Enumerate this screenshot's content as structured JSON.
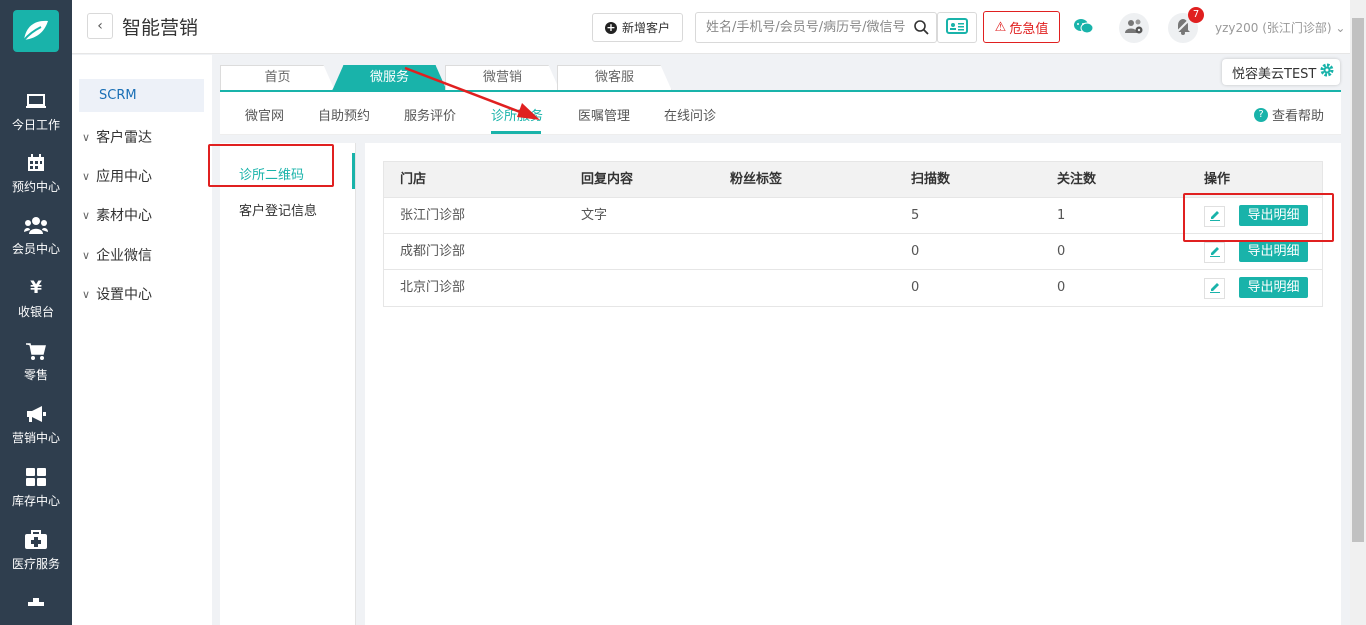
{
  "nav": {
    "items": [
      {
        "label": "今日工作",
        "icon": "monitor-icon"
      },
      {
        "label": "预约中心",
        "icon": "calendar-icon"
      },
      {
        "label": "会员中心",
        "icon": "users-icon"
      },
      {
        "label": "收银台",
        "icon": "yen-icon"
      },
      {
        "label": "零售",
        "icon": "cart-icon"
      },
      {
        "label": "营销中心",
        "icon": "megaphone-icon"
      },
      {
        "label": "库存中心",
        "icon": "grid-icon"
      },
      {
        "label": "医疗服务",
        "icon": "medkit-icon"
      }
    ]
  },
  "header": {
    "title": "智能营销",
    "new_customer": "新增客户",
    "search_placeholder": "姓名/手机号/会员号/病历号/微信号",
    "danger_label": "危急值",
    "notification_count": "7",
    "user": "yzy200 (张江门诊部)"
  },
  "sidebar": {
    "scrm": "SCRM",
    "menu": [
      "客户雷达",
      "应用中心",
      "素材中心",
      "企业微信",
      "设置中心"
    ]
  },
  "tabs": [
    "首页",
    "微服务",
    "微营销",
    "微客服"
  ],
  "org_tag": "悦容美云TEST",
  "subnav": [
    "微官网",
    "自助预约",
    "服务评价",
    "诊所服务",
    "医嘱管理",
    "在线问诊"
  ],
  "help": "查看帮助",
  "left_panel": [
    "诊所二维码",
    "客户登记信息"
  ],
  "table": {
    "headers": [
      "门店",
      "回复内容",
      "粉丝标签",
      "扫描数",
      "关注数",
      "操作"
    ],
    "rows": [
      {
        "store": "张江门诊部",
        "reply": "文字",
        "tag": "",
        "scans": "5",
        "follows": "1",
        "action": "导出明细"
      },
      {
        "store": "成都门诊部",
        "reply": "",
        "tag": "",
        "scans": "0",
        "follows": "0",
        "action": "导出明细"
      },
      {
        "store": "北京门诊部",
        "reply": "",
        "tag": "",
        "scans": "0",
        "follows": "0",
        "action": "导出明细"
      }
    ]
  },
  "colors": {
    "accent": "#19b3aa",
    "nav_bg": "#2f3e4e",
    "danger": "#e02020"
  }
}
